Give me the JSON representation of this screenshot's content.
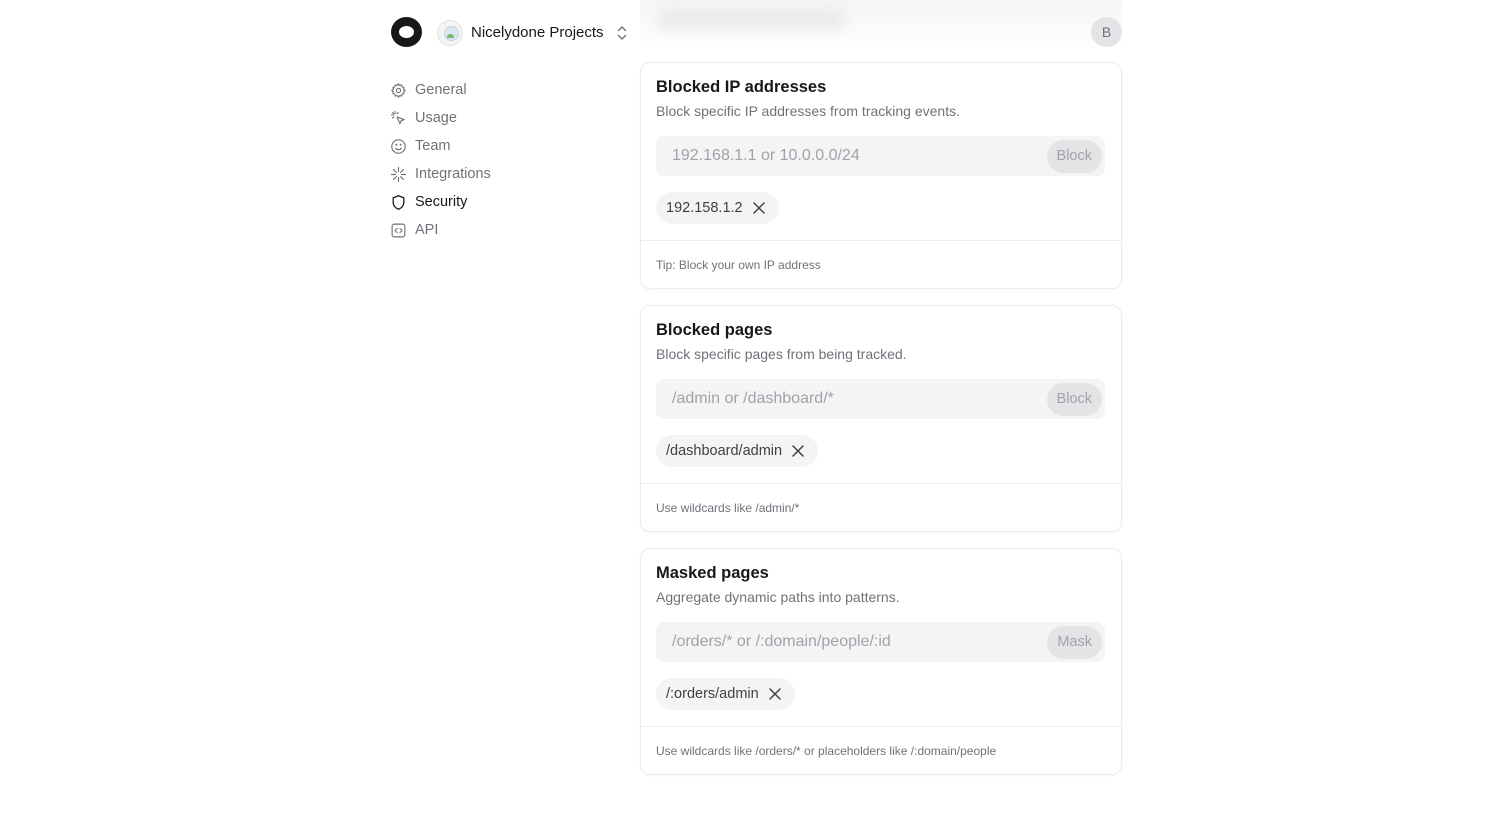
{
  "header": {
    "project_name": "Nicelydone Projects",
    "user_initial": "B"
  },
  "sidebar": {
    "items": [
      {
        "label": "General",
        "icon": "gear-icon",
        "active": false
      },
      {
        "label": "Usage",
        "icon": "cursor-click-icon",
        "active": false
      },
      {
        "label": "Team",
        "icon": "smiley-icon",
        "active": false
      },
      {
        "label": "Integrations",
        "icon": "sparkle-icon",
        "active": false
      },
      {
        "label": "Security",
        "icon": "shield-icon",
        "active": true
      },
      {
        "label": "API",
        "icon": "code-icon",
        "active": false
      }
    ]
  },
  "sections": {
    "blocked_ips": {
      "title": "Blocked IP addresses",
      "description": "Block specific IP addresses from tracking events.",
      "placeholder": "192.168.1.1 or 10.0.0.0/24",
      "value": "",
      "button": "Block",
      "chips": [
        "192.158.1.2"
      ],
      "hint": "Tip: Block your own IP address"
    },
    "blocked_pages": {
      "title": "Blocked pages",
      "description": "Block specific pages from being tracked.",
      "placeholder": "/admin or /dashboard/*",
      "value": "",
      "button": "Block",
      "chips": [
        "/dashboard/admin"
      ],
      "hint": "Use wildcards like /admin/*"
    },
    "masked_pages": {
      "title": "Masked pages",
      "description": "Aggregate dynamic paths into patterns.",
      "placeholder": "/orders/* or /:domain/people/:id",
      "value": "",
      "button": "Mask",
      "chips": [
        "/:orders/admin"
      ],
      "hint": "Use wildcards like /orders/* or placeholders like /:domain/people"
    }
  },
  "colors": {
    "text_primary": "#18181b",
    "text_muted": "#71717a",
    "surface": "#f4f4f5",
    "border": "#ececee"
  }
}
